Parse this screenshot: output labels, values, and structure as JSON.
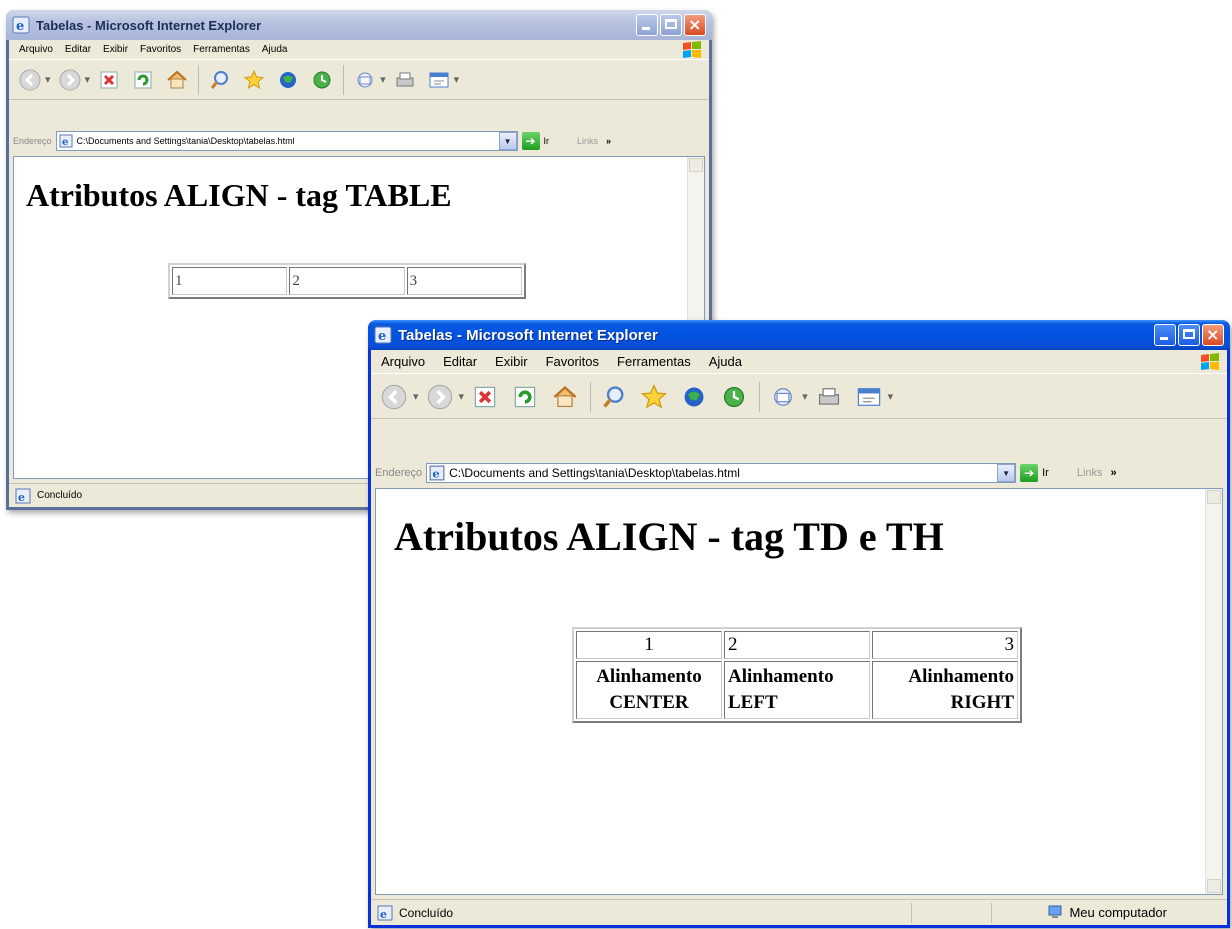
{
  "window1": {
    "title": "Tabelas - Microsoft Internet Explorer",
    "menu": [
      "Arquivo",
      "Editar",
      "Exibir",
      "Favoritos",
      "Ferramentas",
      "Ajuda"
    ],
    "address_label": "Endereço",
    "address_value": "C:\\Documents and Settings\\tania\\Desktop\\tabelas.html",
    "go_label": "Ir",
    "links_label": "Links",
    "links_chevron": "»",
    "heading": "Atributos ALIGN - tag TABLE",
    "table_cells": [
      "1",
      "2",
      "3"
    ],
    "status_text": "Concluído"
  },
  "window2": {
    "title": "Tabelas - Microsoft Internet Explorer",
    "menu": [
      "Arquivo",
      "Editar",
      "Exibir",
      "Favoritos",
      "Ferramentas",
      "Ajuda"
    ],
    "address_label": "Endereço",
    "address_value": "C:\\Documents and Settings\\tania\\Desktop\\tabelas.html",
    "go_label": "Ir",
    "links_label": "Links",
    "links_chevron": "»",
    "heading": "Atributos ALIGN - tag TD e TH",
    "table_row1": [
      "1",
      "2",
      "3"
    ],
    "table_row2": [
      {
        "line1": "Alinhamento",
        "line2": "CENTER"
      },
      {
        "line1": "Alinhamento",
        "line2": "LEFT"
      },
      {
        "line1": "Alinhamento",
        "line2": "RIGHT"
      }
    ],
    "status_text": "Concluído",
    "zone_text": "Meu computador"
  },
  "icons": {
    "back": "back-arrow-icon",
    "forward": "forward-arrow-icon",
    "stop": "stop-icon",
    "refresh": "refresh-icon",
    "home": "home-icon",
    "search": "search-icon",
    "favorites": "favorites-star-icon",
    "media": "media-icon",
    "history": "history-icon",
    "mail": "mail-icon",
    "print": "print-icon",
    "edit": "edit-icon"
  },
  "colors": {
    "active_title": "#0053e1",
    "inactive_title": "#a8b5d8",
    "chrome": "#ece9d8"
  }
}
